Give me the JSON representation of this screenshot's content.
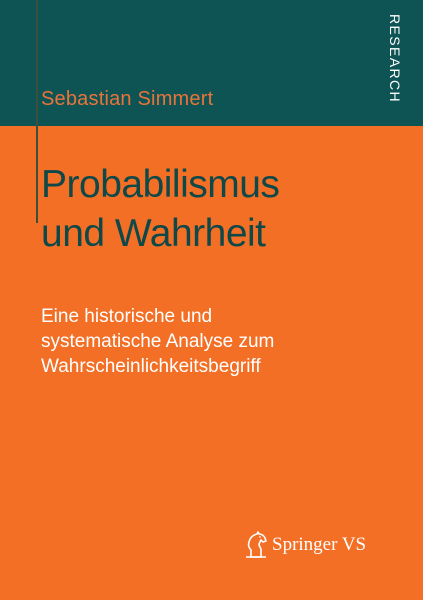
{
  "cover": {
    "author": "Sebastian Simmert",
    "series": "RESEARCH",
    "title_lines": [
      "Probabilismus",
      "und Wahrheit"
    ],
    "subtitle_lines": [
      "Eine historische und",
      "systematische Analyse zum",
      "Wahrscheinlichkeitsbegriff"
    ],
    "publisher": "Springer VS",
    "publisher_logo_icon": "springer-horse-icon"
  },
  "colors": {
    "background": "#f26f25",
    "band": "#0e5454",
    "title": "#0e4848",
    "subtitle": "#ffffff",
    "author": "#e8743a"
  }
}
